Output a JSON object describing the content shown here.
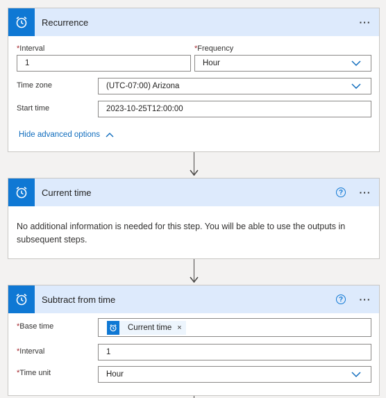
{
  "recurrence": {
    "title": "Recurrence",
    "more": "···",
    "interval_label": "Interval",
    "interval_value": "1",
    "frequency_label": "Frequency",
    "frequency_value": "Hour",
    "timezone_label": "Time zone",
    "timezone_value": "(UTC-07:00) Arizona",
    "starttime_label": "Start time",
    "starttime_value": "2023-10-25T12:00:00",
    "advanced_label": "Hide advanced options"
  },
  "current_time": {
    "title": "Current time",
    "help": "?",
    "more": "···",
    "info": "No additional information is needed for this step. You will be able to use the outputs in subsequent steps."
  },
  "subtract": {
    "title": "Subtract from time",
    "help": "?",
    "more": "···",
    "basetime_label": "Base time",
    "basetime_token": "Current time",
    "token_remove": "×",
    "interval_label": "Interval",
    "interval_value": "1",
    "timeunit_label": "Time unit",
    "timeunit_value": "Hour"
  },
  "required_marker": "*",
  "icons": {
    "trigger": "alarm-clock-icon",
    "dropdown": "chevron-down-icon",
    "collapse": "chevron-up-icon"
  },
  "colors": {
    "accent": "#0f78d4",
    "header_bg": "#ddeafc",
    "link": "#0f6cbd",
    "required": "#a4262c"
  }
}
